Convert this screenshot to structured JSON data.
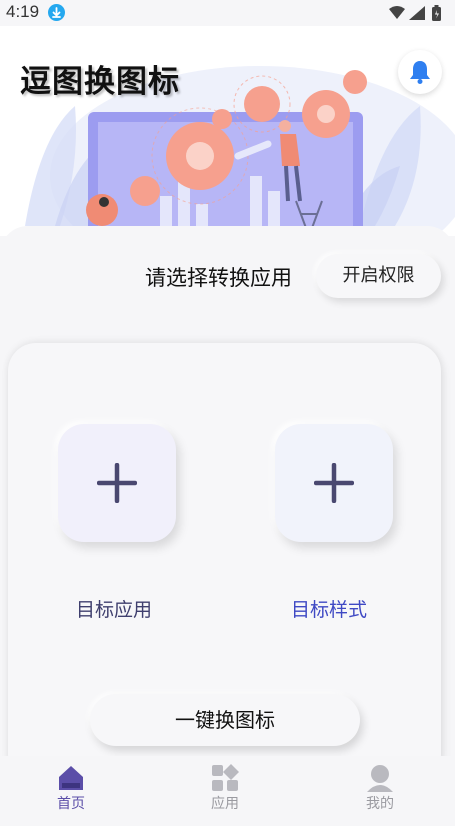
{
  "status_bar": {
    "time": "4:19"
  },
  "header": {
    "title": "逗图换图标"
  },
  "main": {
    "prompt": "请选择转换应用",
    "permission_button": "开启权限",
    "target_app_label": "目标应用",
    "target_style_label": "目标样式",
    "convert_button": "一键换图标"
  },
  "tabs": [
    {
      "label": "首页",
      "icon": "home-icon",
      "active": true
    },
    {
      "label": "应用",
      "icon": "apps-icon",
      "active": false
    },
    {
      "label": "我的",
      "icon": "user-icon",
      "active": false
    }
  ],
  "colors": {
    "accent": "#5b4ea8",
    "bell": "#2f7ff0",
    "style_label": "#3f49c4"
  }
}
